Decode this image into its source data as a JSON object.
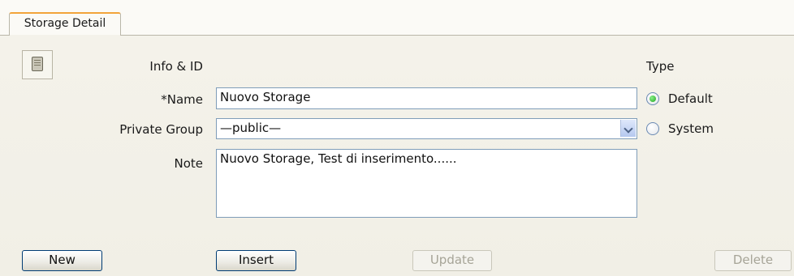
{
  "tabs": [
    {
      "label": "Storage Detail",
      "active": true
    }
  ],
  "form": {
    "info_label": "Info & ID",
    "name_label": "*Name",
    "name_value": "Nuovo Storage",
    "group_label": "Private Group",
    "group_value": "—public—",
    "note_label": "Note",
    "note_value": "Nuovo Storage, Test di inserimento......"
  },
  "type": {
    "label": "Type",
    "options": [
      {
        "label": "Default",
        "selected": true
      },
      {
        "label": "System",
        "selected": false
      }
    ]
  },
  "buttons": {
    "new": "New",
    "insert": "Insert",
    "update": "Update",
    "delete": "Delete"
  },
  "colors": {
    "tab_accent": "#f2a33a",
    "radio_selected": "#1ea51e",
    "input_border": "#7f9db9"
  }
}
